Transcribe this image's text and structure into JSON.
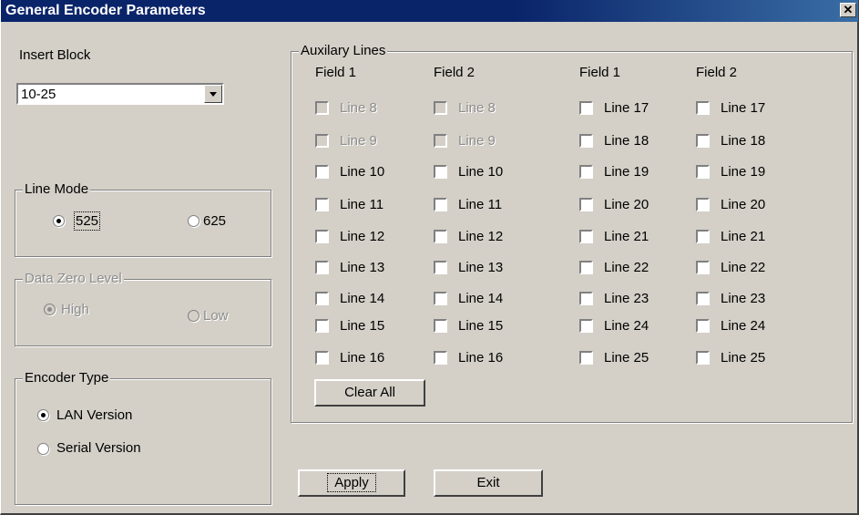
{
  "window": {
    "title": "General Encoder Parameters",
    "close_glyph": "✕"
  },
  "insert_block": {
    "label": "Insert Block",
    "value": "10-25"
  },
  "line_mode": {
    "legend": "Line Mode",
    "opt_525": "525",
    "opt_625": "625",
    "selected": "525"
  },
  "data_zero_level": {
    "legend": "Data Zero Level",
    "opt_high": "High",
    "opt_low": "Low",
    "selected": "High"
  },
  "encoder_type": {
    "legend": "Encoder Type",
    "opt_lan": "LAN Version",
    "opt_serial": "Serial Version",
    "selected": "LAN Version"
  },
  "aux": {
    "legend": "Auxilary Lines",
    "headers": [
      "Field 1",
      "Field 2",
      "Field 1",
      "Field 2"
    ],
    "col1": [
      "Line 8",
      "Line 9",
      "Line 10",
      "Line 11",
      "Line 12",
      "Line 13",
      "Line 14",
      "Line 15",
      "Line 16"
    ],
    "col2": [
      "Line 8",
      "Line 9",
      "Line 10",
      "Line 11",
      "Line 12",
      "Line 13",
      "Line 14",
      "Line 15",
      "Line 16"
    ],
    "col3": [
      "Line 17",
      "Line 18",
      "Line 19",
      "Line 20",
      "Line 21",
      "Line 22",
      "Line 23",
      "Line 24",
      "Line 25"
    ],
    "col4": [
      "Line 17",
      "Line 18",
      "Line 19",
      "Line 20",
      "Line 21",
      "Line 22",
      "Line 23",
      "Line 24",
      "Line 25"
    ],
    "disabled_items": [
      "Line 8",
      "Line 9"
    ],
    "clear_all": "Clear All"
  },
  "buttons": {
    "apply": "Apply",
    "exit": "Exit"
  }
}
